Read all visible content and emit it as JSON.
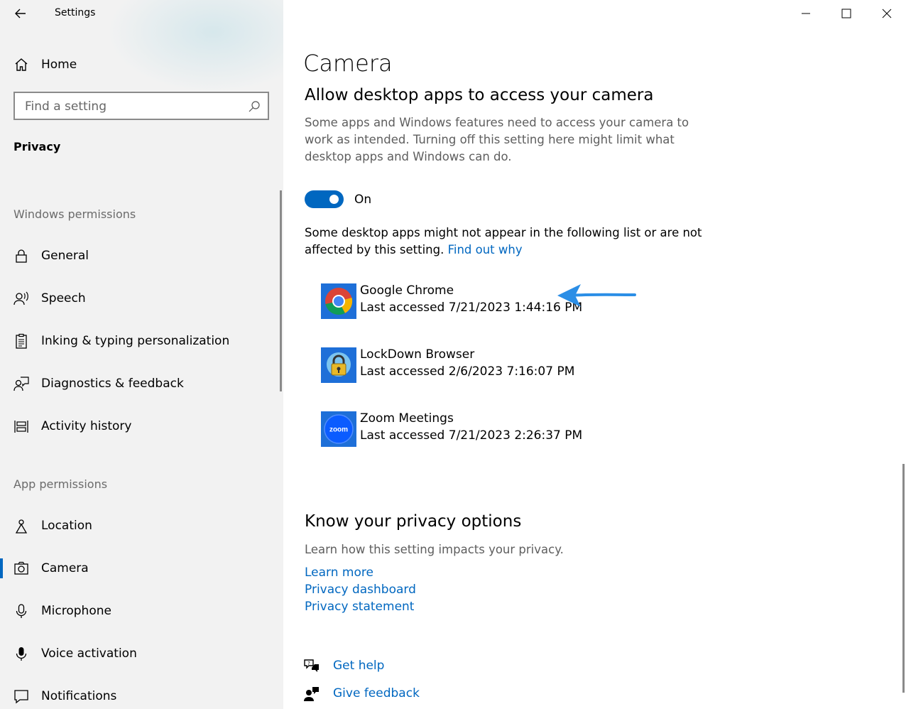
{
  "window": {
    "title": "Settings"
  },
  "sidebar": {
    "home_label": "Home",
    "search_placeholder": "Find a setting",
    "section_title": "Privacy",
    "groups": [
      {
        "header": "Windows permissions",
        "items": [
          {
            "label": "General",
            "icon": "lock-icon"
          },
          {
            "label": "Speech",
            "icon": "speech-icon"
          },
          {
            "label": "Inking & typing personalization",
            "icon": "clipboard-icon"
          },
          {
            "label": "Diagnostics & feedback",
            "icon": "feedback-person-icon"
          },
          {
            "label": "Activity history",
            "icon": "timeline-icon"
          }
        ]
      },
      {
        "header": "App permissions",
        "items": [
          {
            "label": "Location",
            "icon": "location-icon"
          },
          {
            "label": "Camera",
            "icon": "camera-icon",
            "selected": true
          },
          {
            "label": "Microphone",
            "icon": "microphone-icon"
          },
          {
            "label": "Voice activation",
            "icon": "voice-activation-icon"
          },
          {
            "label": "Notifications",
            "icon": "notifications-icon"
          }
        ]
      }
    ]
  },
  "main": {
    "page_title": "Camera",
    "section_heading": "Allow desktop apps to access your camera",
    "section_description": "Some apps and Windows features need to access your camera to work as intended. Turning off this setting here might limit what desktop apps and Windows can do.",
    "toggle": {
      "state": "On",
      "on": true
    },
    "note_text": "Some desktop apps might not appear in the following list or are not affected by this setting.",
    "note_link": "Find out why",
    "apps": [
      {
        "name": "Google Chrome",
        "last_accessed": "Last accessed 7/21/2023 1:44:16 PM",
        "icon": "chrome-icon"
      },
      {
        "name": "LockDown Browser",
        "last_accessed": "Last accessed 2/6/2023 7:16:07 PM",
        "icon": "lockdown-browser-icon"
      },
      {
        "name": "Zoom Meetings",
        "last_accessed": "Last accessed 7/21/2023 2:26:37 PM",
        "icon": "zoom-icon"
      }
    ],
    "privacy": {
      "heading": "Know your privacy options",
      "description": "Learn how this setting impacts your privacy.",
      "links": [
        "Learn more",
        "Privacy dashboard",
        "Privacy statement"
      ]
    },
    "help": {
      "get_help": "Get help",
      "give_feedback": "Give feedback"
    }
  },
  "colors": {
    "accent": "#0067c0",
    "annotation_arrow": "#2b8ee6",
    "sidebar_bg": "#f2f2f2"
  }
}
